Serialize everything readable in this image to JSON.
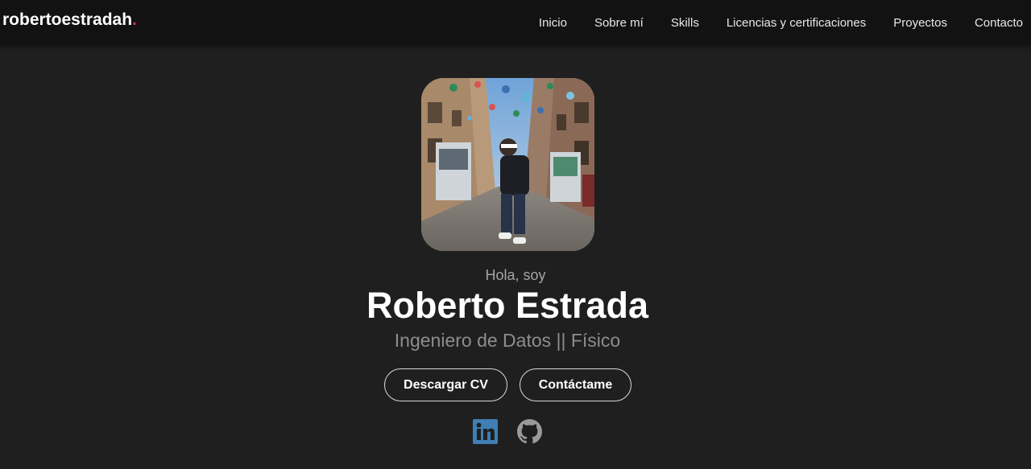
{
  "header": {
    "logo_text": "robertoestradah",
    "logo_dot": ".",
    "nav": [
      {
        "label": "Inicio"
      },
      {
        "label": "Sobre mí"
      },
      {
        "label": "Skills"
      },
      {
        "label": "Licencias y certificaciones"
      },
      {
        "label": "Proyectos"
      },
      {
        "label": "Contacto"
      }
    ]
  },
  "hero": {
    "greeting": "Hola, soy",
    "name": "Roberto Estrada",
    "role": "Ingeniero de Datos || Físico",
    "buttons": {
      "cv": "Descargar CV",
      "contact": "Contáctame"
    },
    "social": [
      {
        "icon": "linkedin-icon"
      },
      {
        "icon": "github-icon"
      }
    ]
  },
  "colors": {
    "background": "#1f1f1f",
    "topbar": "#121212",
    "accent_dot": "#e0245e",
    "linkedin": "#3f7fb5",
    "github": "#9a9a9a"
  }
}
